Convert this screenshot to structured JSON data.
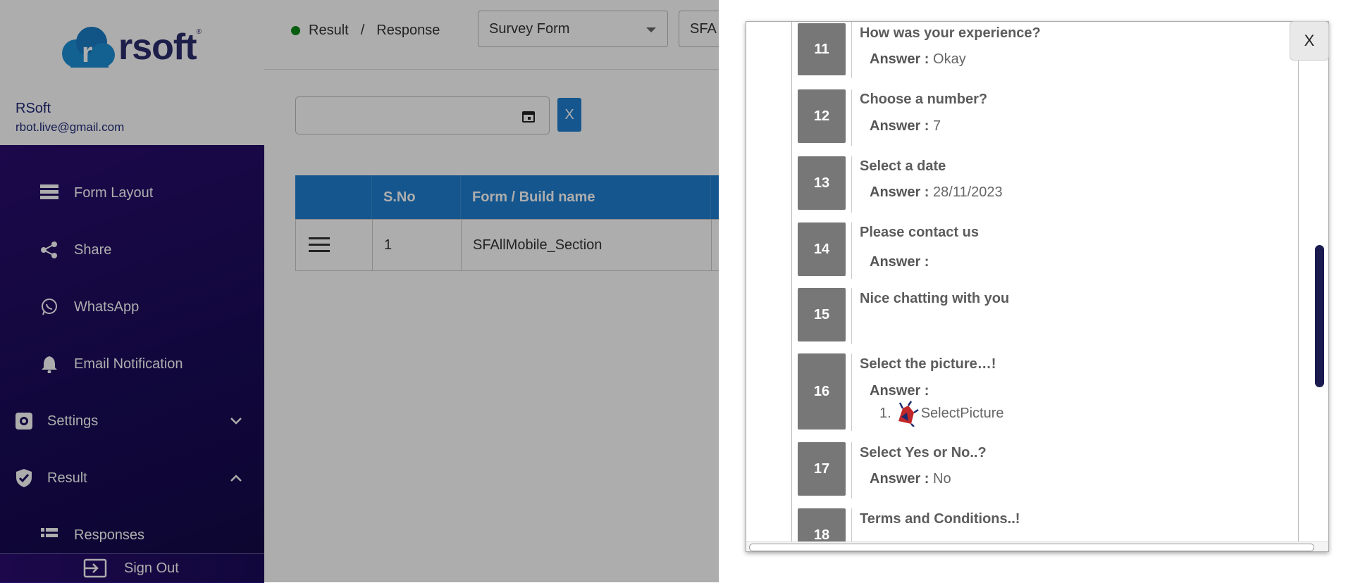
{
  "brand": {
    "logo_text": "rsoft",
    "logo_reg": "®"
  },
  "user": {
    "name": "RSoft",
    "email": "rbot.live@gmail.com"
  },
  "nav": {
    "items": [
      {
        "label": "Form Layout",
        "icon": "form-layout-icon"
      },
      {
        "label": "Share",
        "icon": "share-icon"
      },
      {
        "label": "WhatsApp",
        "icon": "whatsapp-icon"
      },
      {
        "label": "Email Notification",
        "icon": "bell-icon"
      },
      {
        "label": "Settings",
        "icon": "settings-icon",
        "expanded": false
      },
      {
        "label": "Result",
        "icon": "shield-check-icon",
        "expanded": true
      },
      {
        "label": "Responses",
        "icon": "list-icon"
      }
    ],
    "signout": "Sign Out"
  },
  "header": {
    "breadcrumb": {
      "current": "Result",
      "separator": "/",
      "page": "Response"
    },
    "form_select": "Survey Form",
    "build_select": "SFA"
  },
  "filters": {
    "date_value": "",
    "clear_label": "X"
  },
  "table": {
    "columns": [
      "",
      "S.No",
      "Form / Build name"
    ],
    "rows": [
      {
        "sno": "1",
        "name": "SFAllMobile_Section"
      }
    ]
  },
  "drawer": {
    "close_label": "X",
    "answer_prefix": "Answer :",
    "questions": [
      {
        "num": "11",
        "title": "How was your experience?",
        "answer": "Okay"
      },
      {
        "num": "12",
        "title": "Choose a number?",
        "answer": "7"
      },
      {
        "num": "13",
        "title": "Select a date",
        "answer": "28/11/2023"
      },
      {
        "num": "14",
        "title": "Please contact us",
        "answer": ""
      },
      {
        "num": "15",
        "title": "Nice chatting with you"
      },
      {
        "num": "16",
        "title": "Select the picture…!",
        "picture_index": "1.",
        "picture_label": "SelectPicture"
      },
      {
        "num": "17",
        "title": "Select Yes or No..?",
        "answer": "No"
      },
      {
        "num": "18",
        "title": "Terms and Conditions..!"
      }
    ]
  },
  "colors": {
    "accent": "#1f7fd1",
    "nav_bg": "#1a0b5a",
    "status_dot": "#0b8a17",
    "number_badge": "#777777"
  }
}
